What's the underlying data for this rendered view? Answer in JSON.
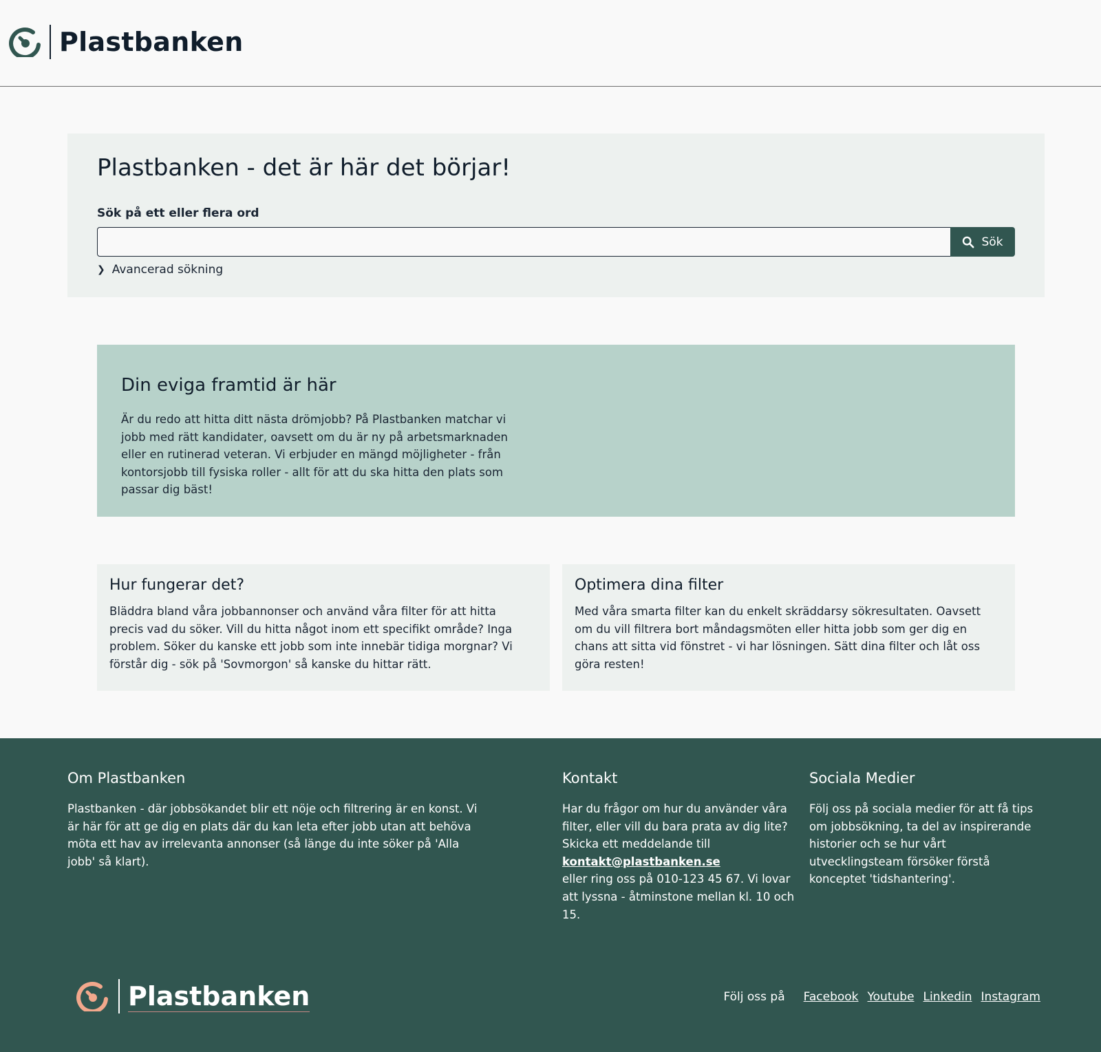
{
  "brand": {
    "name": "Plastbanken",
    "colors": {
      "primary": "#315650",
      "text": "#101d2b",
      "panel": "#edf1ef",
      "hero": "#b7d2ca",
      "accent": "#f2a88c"
    }
  },
  "header": {
    "logo_icon": "plastbanken-logo-icon",
    "logo_text": "Plastbanken"
  },
  "search": {
    "heading": "Plastbanken - det är här det börjar!",
    "label": "Sök på ett eller flera ord",
    "input_value": "",
    "button_label": "Sök",
    "button_icon": "search-icon",
    "advanced_label": "Avancerad sökning",
    "advanced_icon": "chevron-right-icon"
  },
  "hero": {
    "title": "Din eviga framtid är här",
    "text": "Är du redo att hitta ditt nästa drömjobb? På Plastbanken matchar vi jobb med rätt kandidater, oavsett om du är ny på arbetsmarknaden eller en rutinerad veteran. Vi erbjuder en mängd möjligheter - från kontorsjobb till fysiska roller - allt för att du ska hitta den plats som passar dig bäst!"
  },
  "cards": [
    {
      "title": "Hur fungerar det?",
      "text": "Bläddra bland våra jobbannonser och använd våra filter för att hitta precis vad du söker. Vill du hitta något inom ett specifikt område? Inga problem. Söker du kanske ett jobb som inte innebär tidiga morgnar? Vi förstår dig - sök på 'Sovmorgon' så kanske du hittar rätt."
    },
    {
      "title": "Optimera dina filter",
      "text": "Med våra smarta filter kan du enkelt skräddarsy sökresultaten. Oavsett om du vill filtrera bort måndagsmöten eller hitta jobb som ger dig en chans att sitta vid fönstret - vi har lösningen. Sätt dina filter och låt oss göra resten!"
    }
  ],
  "footer": {
    "about": {
      "title": "Om Plastbanken",
      "text": "Plastbanken - där jobbsökandet blir ett nöje och filtrering är en konst. Vi är här för att ge dig en plats där du kan leta efter jobb utan att behöva möta ett hav av irrelevanta annonser (så länge du inte söker på 'Alla jobb' så klart)."
    },
    "contact": {
      "title": "Kontakt",
      "text_before": "Har du frågor om hur du använder våra filter, eller vill du bara prata av dig lite? Skicka ett meddelande till",
      "email": "kontakt@plastbanken.se",
      "text_after": "eller ring oss på 010-123 45 67. Vi lovar att lyssna - åtminstone mellan kl. 10 och 15."
    },
    "social": {
      "title": "Sociala Medier",
      "text": "Följ oss på sociala medier för att få tips om jobbsökning, ta del av inspirerande historier och se hur vårt utvecklingsteam försöker förstå konceptet 'tidshantering'."
    },
    "logo_text": "Plastbanken",
    "follow_label": "Följ oss på",
    "links": [
      "Facebook",
      "Youtube",
      "Linkedin",
      "Instagram"
    ]
  }
}
